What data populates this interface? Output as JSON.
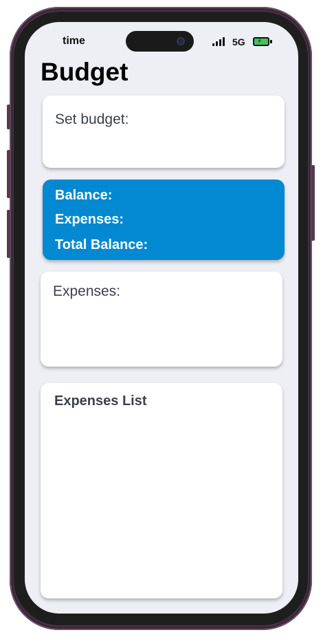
{
  "status_bar": {
    "time": "time",
    "network": "5G"
  },
  "header": {
    "title": "Budget"
  },
  "budget_card": {
    "label": "Set budget:"
  },
  "summary_card": {
    "balance_label": "Balance:",
    "expenses_label": "Expenses:",
    "total_balance_label": "Total Balance:",
    "background_color": "#0289d1"
  },
  "expenses_card": {
    "label": "Expenses:"
  },
  "expenses_list": {
    "title": "Expenses List"
  },
  "icons": {
    "signal": "signal-bars-icon",
    "battery": "battery-charging-icon",
    "camera": "camera-icon"
  }
}
